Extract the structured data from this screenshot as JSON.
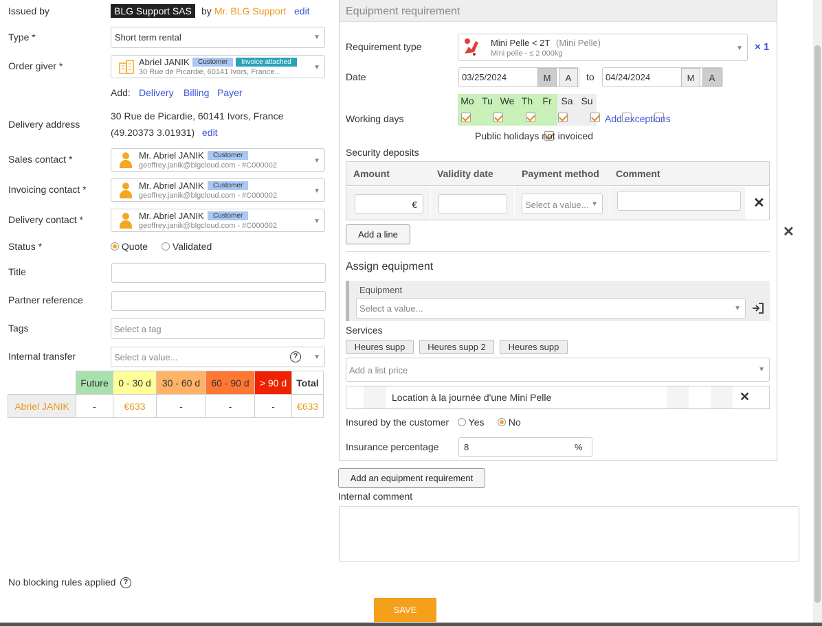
{
  "left": {
    "issued_by_label": "Issued by",
    "issued_by_company": "BLG Support SAS",
    "issued_by_by": "by",
    "issued_by_user": "Mr. BLG Support",
    "issued_by_edit": "edit",
    "type_label": "Type *",
    "type_value": "Short term rental",
    "order_giver_label": "Order giver *",
    "order_giver_name": "Abriel JANIK",
    "order_giver_badge1": "Customer",
    "order_giver_badge2": "Invoice attached",
    "order_giver_address": "30 Rue de Picardie, 60141 Ivors, France...",
    "add_label": "Add:",
    "add_delivery": "Delivery",
    "add_billing": "Billing",
    "add_payer": "Payer",
    "delivery_address_label": "Delivery address",
    "delivery_address_line1": "30 Rue de Picardie, 60141 Ivors, France",
    "delivery_address_coords": "(49.20373 3.01931)",
    "delivery_address_edit": "edit",
    "contacts": [
      {
        "label": "Sales contact *",
        "name": "Mr. Abriel JANIK",
        "badge": "Customer",
        "email": "geoffrey.janik@blgcloud.com - #C000002"
      },
      {
        "label": "Invoicing contact *",
        "name": "Mr. Abriel JANIK",
        "badge": "Customer",
        "email": "geoffrey.janik@blgcloud.com - #C000002"
      },
      {
        "label": "Delivery contact *",
        "name": "Mr. Abriel JANIK",
        "badge": "Customer",
        "email": "geoffrey.janik@blgcloud.com - #C000002"
      }
    ],
    "status_label": "Status *",
    "status_quote": "Quote",
    "status_validated": "Validated",
    "title_label": "Title",
    "title_value": "",
    "partner_ref_label": "Partner reference",
    "partner_ref_value": "",
    "tags_label": "Tags",
    "tags_placeholder": "Select a tag",
    "internal_transfer_label": "Internal transfer",
    "internal_transfer_placeholder": "Select a value...",
    "aging": {
      "headers": [
        "Future",
        "0 - 30 d",
        "30 - 60 d",
        "60 - 90 d",
        "> 90 d",
        "Total"
      ],
      "header_colors": [
        "#a8e0b0",
        "#ffff99",
        "#ffb366",
        "#ff7733",
        "#ee2200",
        "#ffffff"
      ],
      "row_name": "Abriel JANIK",
      "values": [
        "-",
        "€633",
        "-",
        "-",
        "-",
        "€633"
      ]
    },
    "no_blocking": "No blocking rules applied"
  },
  "right": {
    "section_title": "Equipment requirement",
    "req_type_label": "Requirement type",
    "req_type_name": "Mini Pelle < 2T",
    "req_type_paren": "(Mini Pelle)",
    "req_type_sub": "Mini pelle - ≤ 2 000kg",
    "quantity": "× 1",
    "date_label": "Date",
    "date_from": "03/25/2024",
    "date_to": "04/24/2024",
    "to_label": "to",
    "m_label": "M",
    "a_label": "A",
    "working_days_label": "Working days",
    "days": [
      "Mo",
      "Tu",
      "We",
      "Th",
      "Fr",
      "Sa",
      "Su"
    ],
    "days_checked": [
      true,
      true,
      true,
      true,
      true,
      false,
      false
    ],
    "add_exceptions": "Add exceptions",
    "public_holidays": "Public holidays not invoiced",
    "security_deposits_label": "Security deposits",
    "deposit_headers": [
      "Amount",
      "Validity date",
      "Payment method",
      "Comment"
    ],
    "currency": "€",
    "payment_placeholder": "Select a value...",
    "add_line": "Add a line",
    "assign_equipment_title": "Assign equipment",
    "equipment_label": "Equipment",
    "equipment_placeholder": "Select a value...",
    "services_label": "Services",
    "services": [
      "Heures supp",
      "Heures supp 2",
      "Heures supp"
    ],
    "list_price_placeholder": "Add a list price",
    "list_price_item": "Location à la journée d'une Mini Pelle",
    "insured_label": "Insured by the customer",
    "insured_yes": "Yes",
    "insured_no": "No",
    "insurance_pct_label": "Insurance percentage",
    "insurance_pct_value": "8",
    "pct_sign": "%",
    "add_equipment_req": "Add an equipment requirement",
    "internal_comment_label": "Internal comment",
    "save": "SAVE"
  }
}
